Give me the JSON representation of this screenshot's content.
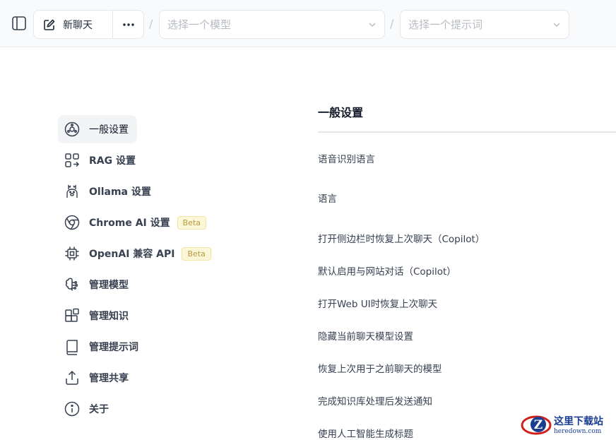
{
  "topbar": {
    "new_chat_label": "新聊天",
    "model_placeholder": "选择一个模型",
    "prompt_placeholder": "选择一个提示词",
    "separator": "/"
  },
  "nav": {
    "items": [
      {
        "label": "一般设置",
        "icon": "settings-icon",
        "active": true
      },
      {
        "label": "RAG 设置",
        "icon": "rag-icon"
      },
      {
        "label": "Ollama 设置",
        "icon": "llama-icon"
      },
      {
        "label": "Chrome AI 设置",
        "icon": "chrome-icon",
        "badge": "Beta"
      },
      {
        "label": "OpenAI 兼容 API",
        "icon": "chip-icon",
        "badge": "Beta"
      },
      {
        "label": "管理模型",
        "icon": "brain-icon"
      },
      {
        "label": "管理知识",
        "icon": "blocks-icon"
      },
      {
        "label": "管理提示词",
        "icon": "book-icon"
      },
      {
        "label": "管理共享",
        "icon": "share-icon"
      },
      {
        "label": "关于",
        "icon": "info-icon"
      }
    ]
  },
  "panel": {
    "title": "一般设置",
    "settings": [
      "语音识别语言",
      "语言",
      "打开侧边栏时恢复上次聊天（Copilot）",
      "默认启用与网站对话（Copilot）",
      "打开Web UI时恢复上次聊天",
      "隐藏当前聊天模型设置",
      "恢复上次用于之前聊天的模型",
      "完成知识库处理后发送通知",
      "使用人工智能生成标题"
    ]
  },
  "watermark": {
    "text": "这里下载站",
    "url": "heredown.com"
  },
  "colors": {
    "active_bg": "#f3f4f6",
    "badge_bg": "#fdf7d9",
    "badge_text": "#b49a3c",
    "watermark_blue": "#1a3d8f",
    "watermark_red": "#d0201b"
  }
}
